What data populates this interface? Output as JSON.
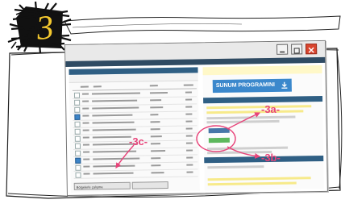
{
  "step_number": "3",
  "download_button": {
    "label": "SUNUM PROGRAMINI İNDİR"
  },
  "bottom_field": {
    "label": "Bölgelerle çalışma"
  },
  "callouts": [
    {
      "id": "3a",
      "label": "-3a-"
    },
    {
      "id": "3b",
      "label": "-3b-"
    },
    {
      "id": "3c",
      "label": "-3c-"
    }
  ],
  "colors": {
    "accent_blue": "#3b88cc",
    "annotation_pink": "#e8447a",
    "close_red": "#d9452e",
    "header_navy": "#2f5f84"
  }
}
